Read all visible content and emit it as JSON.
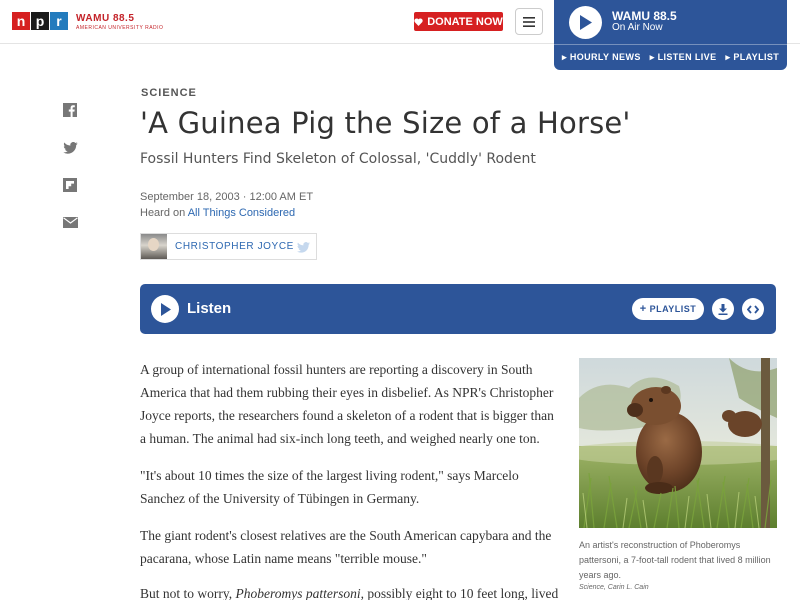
{
  "header": {
    "logo_letters": [
      "n",
      "p",
      "r"
    ],
    "station_name": "WAMU 88.5",
    "station_tagline": "AMERICAN UNIVERSITY RADIO",
    "donate_label": "DONATE NOW",
    "brand_red": "#d62021"
  },
  "station": {
    "name": "WAMU 88.5",
    "status": "On Air Now",
    "links": [
      "HOURLY NEWS",
      "LISTEN LIVE",
      "PLAYLIST"
    ],
    "color": "#2d5599"
  },
  "article": {
    "slug": "SCIENCE",
    "title": "'A Guinea Pig the Size of a Horse'",
    "subtitle": "Fossil Hunters Find Skeleton of Colossal, 'Cuddly' Rodent",
    "date": "September 18, 2003 · 12:00 AM ET",
    "heard_on_prefix": "Heard on",
    "heard_on_show": "All Things Considered",
    "author": "CHRISTOPHER JOYCE"
  },
  "listen": {
    "label": "Listen",
    "playlist_label": "PLAYLIST"
  },
  "body": {
    "p1": "A group of international fossil hunters are reporting a discovery in South America that had them rubbing their eyes in disbelief. As NPR's Christopher Joyce reports, the researchers found a skeleton of a rodent that is bigger than a human. The animal had six-inch long teeth, and weighed nearly one ton.",
    "p2": "\"It's about 10 times the size of the largest living rodent,\" says Marcelo Sanchez of the University of Tübingen in Germany.",
    "p3": "The giant rodent's closest relatives are the South American capybara and the pacarana, whose Latin name means \"terrible mouse.\"",
    "p4_start": "But not to worry, ",
    "p4_italic": "Phoberomys pattersoni",
    "p4_end": ", possibly eight to 10 feet long, lived"
  },
  "figure": {
    "caption": "An artist's reconstruction of Phoberomys pattersoni, a 7-foot-tall rodent that lived 8 million years ago.",
    "credit": "Science, Carin L. Cain"
  },
  "icons": {
    "social": [
      "facebook-icon",
      "twitter-icon",
      "flipboard-icon",
      "email-icon"
    ]
  }
}
